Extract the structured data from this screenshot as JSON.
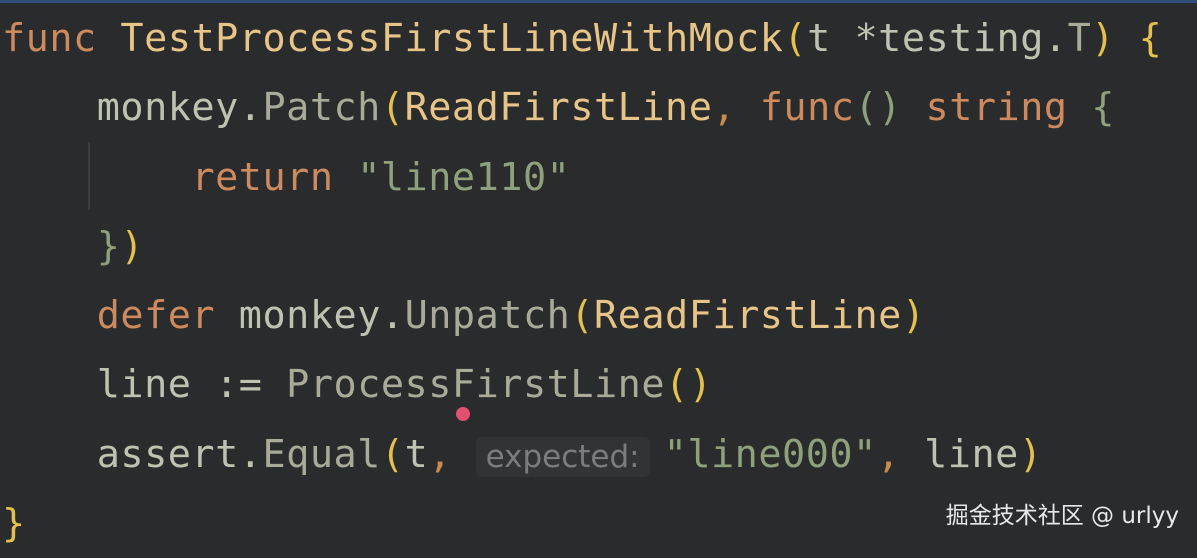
{
  "editor": {
    "language": "go",
    "colors": {
      "background": "#2a2b2c",
      "keyword": "#cc8a5e",
      "function": "#e7c487",
      "identifier": "#bfc2b0",
      "string": "#8fa17c",
      "paren": "#e4c04d"
    },
    "lines": [
      [
        {
          "t": "kw",
          "v": "func "
        },
        {
          "t": "fn",
          "v": "TestProcessFirstLineWithMock"
        },
        {
          "t": "paren",
          "v": "("
        },
        {
          "t": "id",
          "v": "t "
        },
        {
          "t": "id",
          "v": "*testing."
        },
        {
          "t": "call",
          "v": "T"
        },
        {
          "t": "paren",
          "v": ")"
        },
        {
          "t": "id",
          "v": " "
        },
        {
          "t": "paren",
          "v": "{"
        }
      ],
      [
        {
          "t": "id",
          "v": "    monkey."
        },
        {
          "t": "call",
          "v": "Patch"
        },
        {
          "t": "paren",
          "v": "("
        },
        {
          "t": "fn",
          "v": "ReadFirstLine"
        },
        {
          "t": "punc",
          "v": ", "
        },
        {
          "t": "kw",
          "v": "func"
        },
        {
          "t": "str",
          "v": "() "
        },
        {
          "t": "kw",
          "v": "string "
        },
        {
          "t": "str",
          "v": "{"
        }
      ],
      [
        {
          "t": "id",
          "v": "        "
        },
        {
          "t": "kw",
          "v": "return "
        },
        {
          "t": "str",
          "v": "\"line110\""
        }
      ],
      [
        {
          "t": "id",
          "v": "    "
        },
        {
          "t": "str",
          "v": "}"
        },
        {
          "t": "paren",
          "v": ")"
        }
      ],
      [
        {
          "t": "id",
          "v": "    "
        },
        {
          "t": "kw",
          "v": "defer "
        },
        {
          "t": "id",
          "v": "monkey."
        },
        {
          "t": "call",
          "v": "Unpatch"
        },
        {
          "t": "paren",
          "v": "("
        },
        {
          "t": "fn",
          "v": "ReadFirstLine"
        },
        {
          "t": "paren",
          "v": ")"
        }
      ],
      [
        {
          "t": "id",
          "v": "    line := "
        },
        {
          "t": "call",
          "v": "ProcessFirstLine"
        },
        {
          "t": "paren",
          "v": "()"
        }
      ],
      [
        {
          "t": "id",
          "v": "    assert."
        },
        {
          "t": "call",
          "v": "Equal"
        },
        {
          "t": "paren",
          "v": "("
        },
        {
          "t": "id",
          "v": "t"
        },
        {
          "t": "punc",
          "v": ", "
        },
        {
          "t": "hint",
          "v": "expected:"
        },
        {
          "t": "str",
          "v": "\"line000\""
        },
        {
          "t": "punc",
          "v": ", "
        },
        {
          "t": "id",
          "v": "line"
        },
        {
          "t": "paren",
          "v": ")"
        }
      ],
      [
        {
          "t": "paren",
          "v": "}"
        }
      ]
    ]
  },
  "watermark": "掘金技术社区 @ urlyy"
}
